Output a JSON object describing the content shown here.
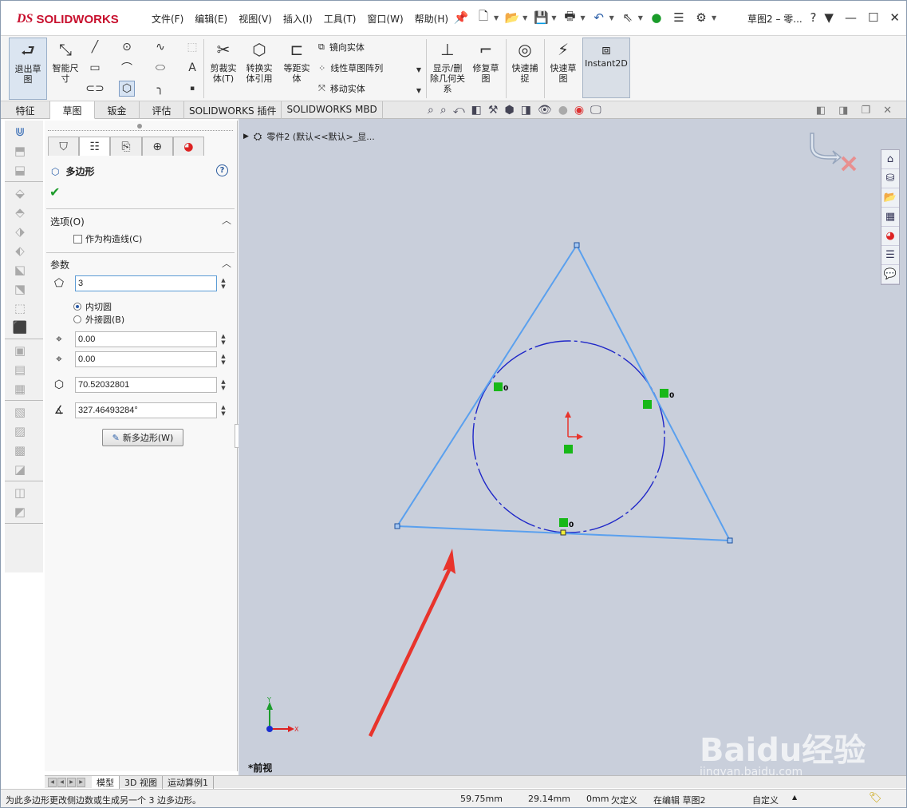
{
  "app": {
    "logo_ds": "DS",
    "logo_name": "SOLIDWORKS",
    "doc_title": "草图2 – 零..."
  },
  "menu": [
    "文件(F)",
    "编辑(E)",
    "视图(V)",
    "插入(I)",
    "工具(T)",
    "窗口(W)",
    "帮助(H)"
  ],
  "ribbon": {
    "exit_sketch": "退出草图",
    "smart_dim": "智能尺寸",
    "trim": "剪裁实体(T)",
    "convert": "转换实体引用",
    "offset": "等距实体",
    "mirror": "镜向实体",
    "linear_pattern": "线性草图阵列",
    "move": "移动实体",
    "display_relations": "显示/删除几何关系",
    "repair": "修复草图",
    "quick_snap": "快速捕捉",
    "rapid_sketch": "快速草图",
    "instant2d": "Instant2D"
  },
  "tabs": [
    "特征",
    "草图",
    "钣金",
    "评估",
    "SOLIDWORKS 插件",
    "SOLIDWORKS MBD"
  ],
  "active_tab": "草图",
  "pm": {
    "title": "多边形",
    "help": "?",
    "ok": "✔",
    "options_header": "选项(O)",
    "construction_label": "作为构造线(C)",
    "params_header": "参数",
    "sides": "3",
    "inscribed": "内切圆",
    "circumscribed": "外接圆(B)",
    "center_x": "0.00",
    "center_y": "0.00",
    "diameter": "70.52032801",
    "angle": "327.46493284°",
    "new_polygon": "新多边形(W)"
  },
  "graphics": {
    "tree_label": "零件2  (默认<<默认>_显...",
    "view_label": "*前视",
    "axis_x": "X",
    "axis_y": "Y",
    "relation_tag": "0",
    "watermark_brand": "Baidu经验",
    "watermark_url": "jingyan.baidu.com"
  },
  "bottom_tabs": [
    "模型",
    "3D 视图",
    "运动算例1"
  ],
  "status": {
    "hint": "为此多边形更改侧边数或生成另一个 3 边多边形。",
    "x": "59.75mm",
    "y": "29.14mm",
    "z": "0mm",
    "defined": "欠定义",
    "editing": "在编辑 草图2",
    "units": "自定义"
  },
  "colors": {
    "sketch_line": "#5aa0ee",
    "circle": "#1f27c8",
    "arrow": "#e8342c",
    "relation": "#18b818"
  }
}
